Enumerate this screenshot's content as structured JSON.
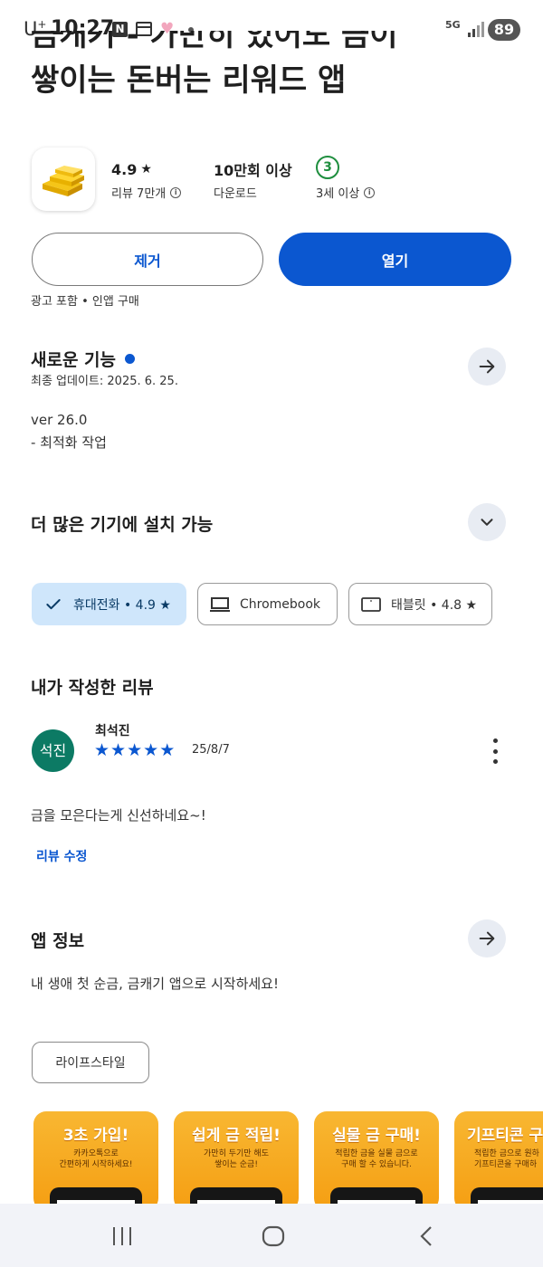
{
  "status_bar": {
    "carrier": "U",
    "carrier_sup": "+",
    "time": "10:27",
    "notif_n": "N",
    "network": "5G",
    "battery": "89"
  },
  "app": {
    "title_line1": "금캐기 - 가만히 있어도 금이",
    "title_line2": "쌓이는 돈버는 리워드 앱",
    "rating": "4.9",
    "rating_label": "리뷰 7만개",
    "downloads": "10만회 이상",
    "downloads_label": "다운로드",
    "age_rating": "3",
    "age_label": "3세 이상"
  },
  "actions": {
    "remove_label": "제거",
    "open_label": "열기",
    "ads_note": "광고 포함 • 인앱 구매"
  },
  "whats_new": {
    "heading": "새로운 기능",
    "updated": "최종 업데이트: 2025. 6. 25.",
    "version": "ver 26.0",
    "notes": "- 최적화 작업"
  },
  "devices": {
    "heading": "더 많은 기기에 설치 가능",
    "chips": [
      {
        "label": "휴대전화 • 4.9 ★"
      },
      {
        "label": "Chromebook"
      },
      {
        "label": "태블릿 • 4.8 ★"
      }
    ]
  },
  "my_review": {
    "heading": "내가 작성한 리뷰",
    "avatar_text": "석진",
    "author": "최석진",
    "stars": 5,
    "date": "25/8/7",
    "text": "금을 모은다는게 신선하네요~!",
    "edit_label": "리뷰 수정"
  },
  "app_info": {
    "heading": "앱 정보",
    "description": "내 생애 첫 순금, 금캐기 앱으로 시작하세요!",
    "category": "라이프스타일"
  },
  "screenshots": [
    {
      "title": "3초 가입!",
      "desc1": "카카오톡으로",
      "desc2": "간편하게 시작하세요!"
    },
    {
      "title": "쉽게 금 적립!",
      "desc1": "가만히 두기만 해도",
      "desc2": "쌓이는 순금!"
    },
    {
      "title": "실물 금 구매!",
      "desc1": "적립한 금을 실물 금으로",
      "desc2": "구매 할 수 있습니다."
    },
    {
      "title": "기프티콘 구",
      "desc1": "적립한 금으로 원하",
      "desc2": "기프티콘을 구매하"
    }
  ],
  "colors": {
    "accent": "#0b57d0",
    "chip_selected": "#cfe6fb",
    "avatar": "#0c7a64",
    "age_badge": "#1e8e3e",
    "screenshot_bg": "#f7a91e"
  }
}
